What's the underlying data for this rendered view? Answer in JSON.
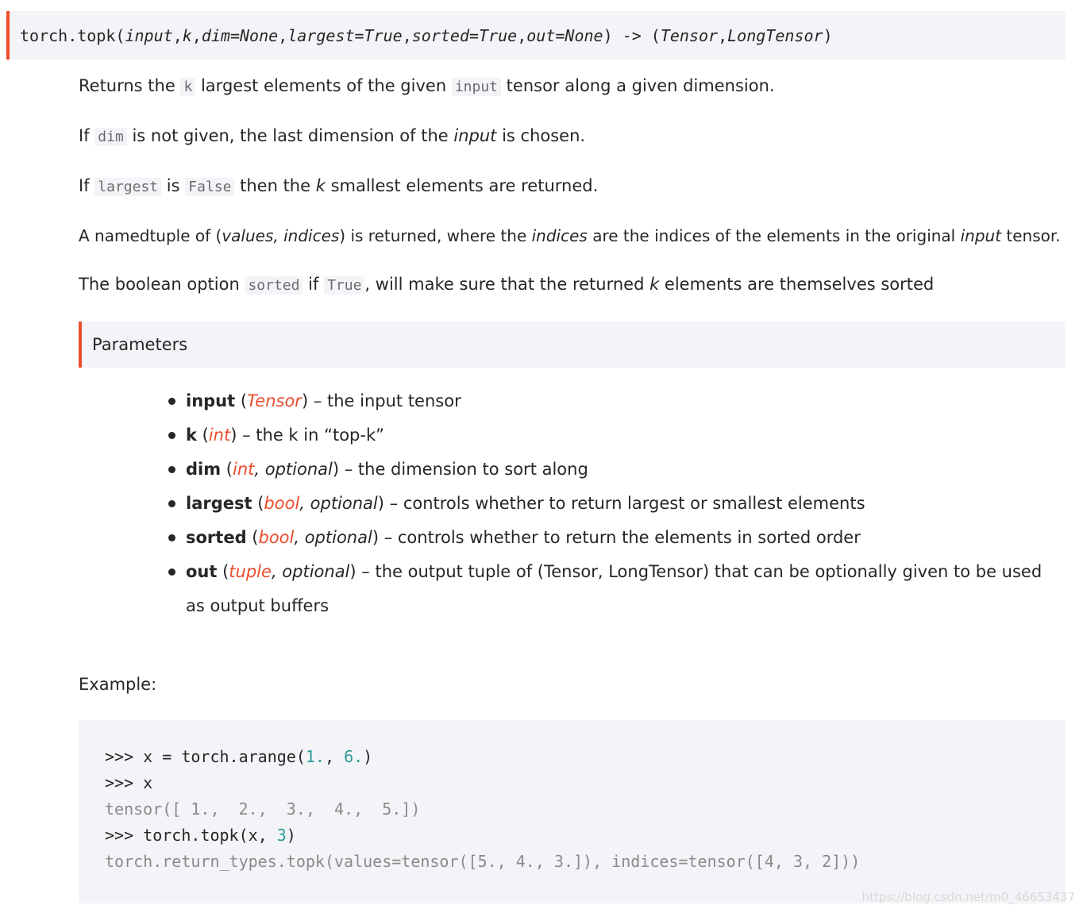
{
  "signature": {
    "func": "torch.topk",
    "open": "(",
    "params": [
      "input",
      "k",
      "dim=None",
      "largest=True",
      "sorted=True",
      "out=None"
    ],
    "close": ")",
    "arrow": " -> ",
    "return_open": "(",
    "returns": [
      "Tensor",
      "LongTensor"
    ],
    "return_close": ")"
  },
  "paragraphs": {
    "p1": {
      "a": "Returns the ",
      "c1": "k",
      "b": " largest elements of the given ",
      "c2": "input",
      "c": " tensor along a given dimension."
    },
    "p2": {
      "a": "If ",
      "c1": "dim",
      "b": " is not given, the last dimension of the ",
      "em": "input",
      "c": " is chosen."
    },
    "p3": {
      "a": "If ",
      "c1": "largest",
      "b": " is ",
      "c2": "False",
      "c": " then the ",
      "em": "k",
      "d": " smallest elements are returned."
    },
    "p4": {
      "a": "A namedtuple of (",
      "em1": "values, indices",
      "b": ") is returned, where the ",
      "em2": "indices",
      "c": " are the indices of the elements in the original ",
      "em3": "input",
      "d": " tensor."
    },
    "p5": {
      "a": "The boolean option ",
      "c1": "sorted",
      "b": " if ",
      "c2": "True",
      "c": ", will make sure that the returned ",
      "em": "k",
      "d": " elements are themselves sorted"
    }
  },
  "parameters_title": "Parameters",
  "parameters": [
    {
      "name": "input",
      "open": " (",
      "type": "Tensor",
      "opt": "",
      "close": ")",
      "desc": " – the input tensor"
    },
    {
      "name": "k",
      "open": " (",
      "type": "int",
      "opt": "",
      "close": ")",
      "desc": " – the k in “top-k”"
    },
    {
      "name": "dim",
      "open": " (",
      "type": "int",
      "opt": ", optional",
      "close": ")",
      "desc": " – the dimension to sort along"
    },
    {
      "name": "largest",
      "open": " (",
      "type": "bool",
      "opt": ", optional",
      "close": ")",
      "desc": " – controls whether to return largest or smallest elements"
    },
    {
      "name": "sorted",
      "open": " (",
      "type": "bool",
      "opt": ", optional",
      "close": ")",
      "desc": " – controls whether to return the elements in sorted order"
    },
    {
      "name": "out",
      "open": " (",
      "type": "tuple",
      "opt": ", optional",
      "close": ")",
      "desc": " – the output tuple of (Tensor, LongTensor) that can be optionally given to be used as output buffers"
    }
  ],
  "example_label": "Example:",
  "code": {
    "l1": {
      "a": ">>> x = torch.arange(",
      "n1": "1.",
      "b": ", ",
      "n2": "6.",
      "c": ")"
    },
    "l2": ">>> x",
    "l3": "tensor([ 1.,  2.,  3.,  4.,  5.])",
    "l4": {
      "a": ">>> torch.topk(x, ",
      "n1": "3",
      "b": ")"
    },
    "l5": "torch.return_types.topk(values=tensor([5., 4., 3.]), indices=tensor([4, 3, 2]))"
  },
  "watermark": "https://blog.csdn.net/m0_46653437",
  "colors": {
    "accent": "#ee4c2c",
    "code_bg": "#f3f4f7",
    "number": "#2e9a98"
  }
}
